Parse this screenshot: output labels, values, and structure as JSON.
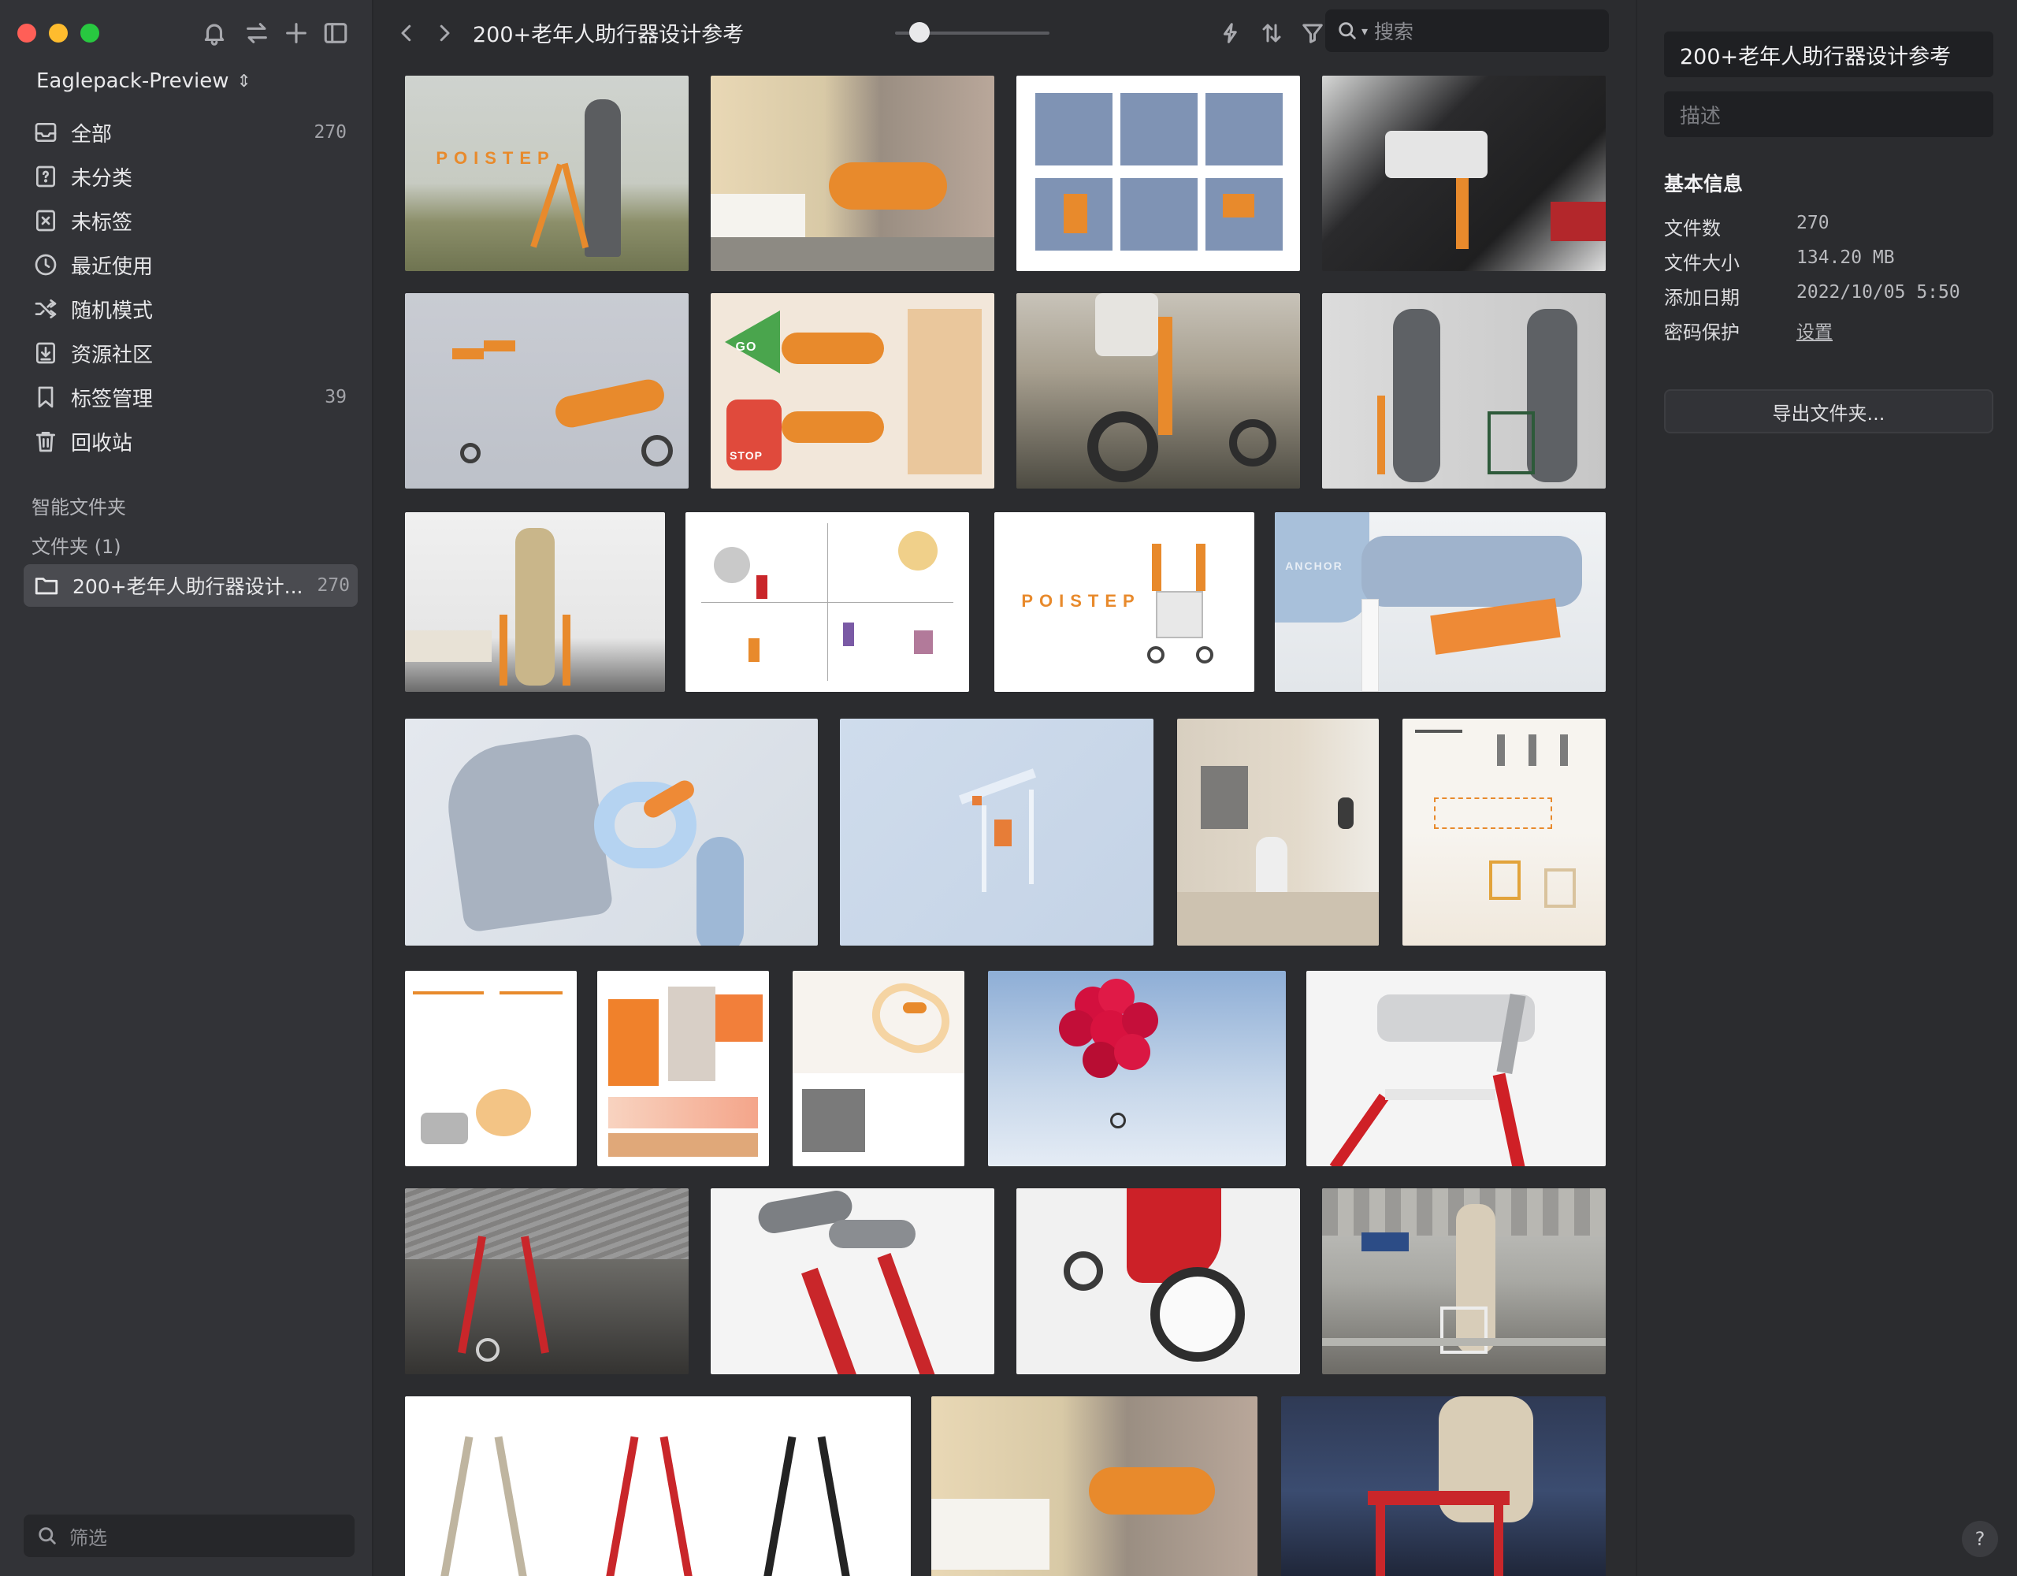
{
  "window": {
    "traffic_lights": [
      "close",
      "minimize",
      "zoom"
    ]
  },
  "sidebar": {
    "library_name": "Eaglepack-Preview",
    "library_switch_glyph": "⌃",
    "toolbar_icons": [
      "bell-icon",
      "sync-icon",
      "plus-icon",
      "sidebar-toggle-icon"
    ],
    "nav": [
      {
        "label": "全部",
        "count": "270",
        "icon": "inbox-icon"
      },
      {
        "label": "未分类",
        "count": "",
        "icon": "question-box-icon"
      },
      {
        "label": "未标签",
        "count": "",
        "icon": "untagged-icon"
      },
      {
        "label": "最近使用",
        "count": "",
        "icon": "clock-icon"
      },
      {
        "label": "随机模式",
        "count": "",
        "icon": "shuffle-icon"
      },
      {
        "label": "资源社区",
        "count": "",
        "icon": "download-box-icon"
      },
      {
        "label": "标签管理",
        "count": "39",
        "icon": "bookmark-icon"
      },
      {
        "label": "回收站",
        "count": "",
        "icon": "trash-icon"
      }
    ],
    "smart_folders_label": "智能文件夹",
    "folders_label": "文件夹 (1)",
    "folder": {
      "label": "200+老年人助行器设计...",
      "count": "270"
    },
    "filter_placeholder": "筛选"
  },
  "toolbar": {
    "title": "200+老年人助行器设计参考",
    "zoom_fraction": 0.16,
    "search_placeholder": "搜索",
    "action_icons": [
      "flash-icon",
      "sort-icon",
      "filter-icon"
    ]
  },
  "gallery": {
    "thumb_texts": {
      "poistep_1": "POISTEP",
      "poistep_2": "POISTEP",
      "go": "GO",
      "stop": "STOP",
      "anchor": "ANCHOR"
    }
  },
  "inspector": {
    "name": "200+老年人助行器设计参考",
    "description_placeholder": "描述",
    "section_title": "基本信息",
    "rows": [
      {
        "key": "文件数",
        "value": "270"
      },
      {
        "key": "文件大小",
        "value": "134.20 MB"
      },
      {
        "key": "添加日期",
        "value": "2022/10/05 5:50"
      },
      {
        "key": "密码保护",
        "value": "设置"
      }
    ],
    "export_label": "导出文件夹...",
    "help_label": "?"
  },
  "colors": {
    "accent_orange": "#e88a2c",
    "red_walker": "#c9262a",
    "sidebar_bg": "#323337",
    "panel_bg": "#2b2c2f"
  }
}
